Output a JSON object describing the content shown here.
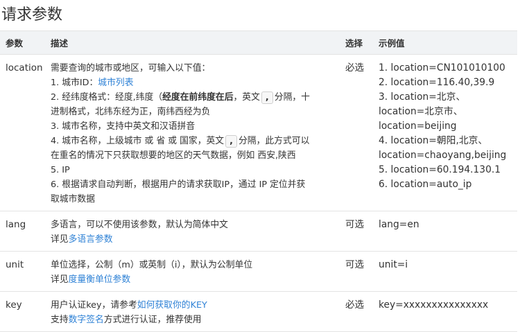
{
  "title": "请求参数",
  "table": {
    "headers": [
      "参数",
      "描述",
      "选择",
      "示例值"
    ],
    "location": {
      "param": "location",
      "choice": "必选",
      "desc": {
        "intro": "需要查询的城市或地区，可输入以下值：",
        "item1_prefix": "1. 城市ID：",
        "item1_link": "城市列表",
        "item2_a": "2. 经纬度格式：经度,纬度（",
        "item2_bold": "经度在前纬度在后",
        "item2_b": "，英文",
        "item2_box": ",",
        "item2_c": "分隔，十",
        "item2_d": "进制格式，北纬东经为正，南纬西经为负",
        "item3": "3. 城市名称，支持中英文和汉语拼音",
        "item4_a": "4. 城市名称，上级城市 或 省 或 国家，英文",
        "item4_box": ",",
        "item4_b": "分隔，此方式可以",
        "item4_c": "在重名的情况下只获取想要的地区的天气数据，例如 西安,陕西",
        "item5": "5. IP",
        "item6_a": "6. 根据请求自动判断，根据用户的请求获取IP，通过 IP 定位并获",
        "item6_b": "取城市数据"
      },
      "examples": [
        "1. location=CN101010100",
        "2. location=116.40,39.9",
        "3. location=北京、",
        "location=北京市、",
        "location=beijing",
        "4. location=朝阳,北京、",
        "location=chaoyang,beijing",
        "5. location=60.194.130.1",
        "6. location=auto_ip"
      ]
    },
    "lang": {
      "param": "lang",
      "choice": "可选",
      "desc_line1": "多语言，可以不使用该参数，默认为简体中文",
      "desc_prefix": "详见",
      "desc_link": "多语言参数",
      "example": "lang=en"
    },
    "unit": {
      "param": "unit",
      "choice": "可选",
      "desc_line1": "单位选择，公制（m）或英制（i），默认为公制单位",
      "desc_prefix": "详见",
      "desc_link": "度量衡单位参数",
      "example": "unit=i"
    },
    "key": {
      "param": "key",
      "choice": "必选",
      "desc_prefix1": "用户认证key，请参考",
      "desc_link1": "如何获取你的KEY",
      "desc_prefix2": "支持",
      "desc_link2": "数字签名",
      "desc_suffix2": "方式进行认证，推荐使用",
      "example": "key=xxxxxxxxxxxxxxx"
    }
  }
}
